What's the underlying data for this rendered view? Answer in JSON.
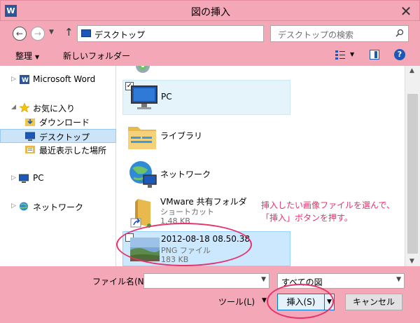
{
  "window": {
    "title": "図の挿入",
    "app_icon": "W",
    "close": "✕"
  },
  "address": {
    "location": "デスクトップ",
    "search_placeholder": "デスクトップの検索"
  },
  "toolbar": {
    "organize_label": "整理",
    "new_folder_label": "新しいフォルダー"
  },
  "sidebar": {
    "items": [
      {
        "label": "Microsoft Word"
      },
      {
        "label": "お気に入り"
      },
      {
        "label": "ダウンロード"
      },
      {
        "label": "デスクトップ"
      },
      {
        "label": "最近表示した場所"
      },
      {
        "label": "PC"
      },
      {
        "label": "ネットワーク"
      }
    ]
  },
  "files": [
    {
      "name": "PC"
    },
    {
      "name": "ライブラリ"
    },
    {
      "name": "ネットワーク"
    },
    {
      "name": "VMware 共有フォルダ",
      "type": "ショートカット",
      "size": "1.48 KB"
    },
    {
      "name": "2012-08-18 08.50.38",
      "type": "PNG ファイル",
      "size": "183 KB"
    }
  ],
  "annotation": {
    "line1": "挿入したい画像ファイルを選んで、",
    "line2": "「挿入」ボタンを押す。"
  },
  "bottom": {
    "filename_label": "ファイル名(N):",
    "filename_value": "",
    "filetype_value": "すべての図",
    "tools_label": "ツール(L)",
    "insert_label": "挿入(S)",
    "cancel_label": "キャンセル"
  },
  "colors": {
    "frame": "#f3a7b7",
    "annotation": "#e8326a",
    "selection": "#cce4f7"
  }
}
